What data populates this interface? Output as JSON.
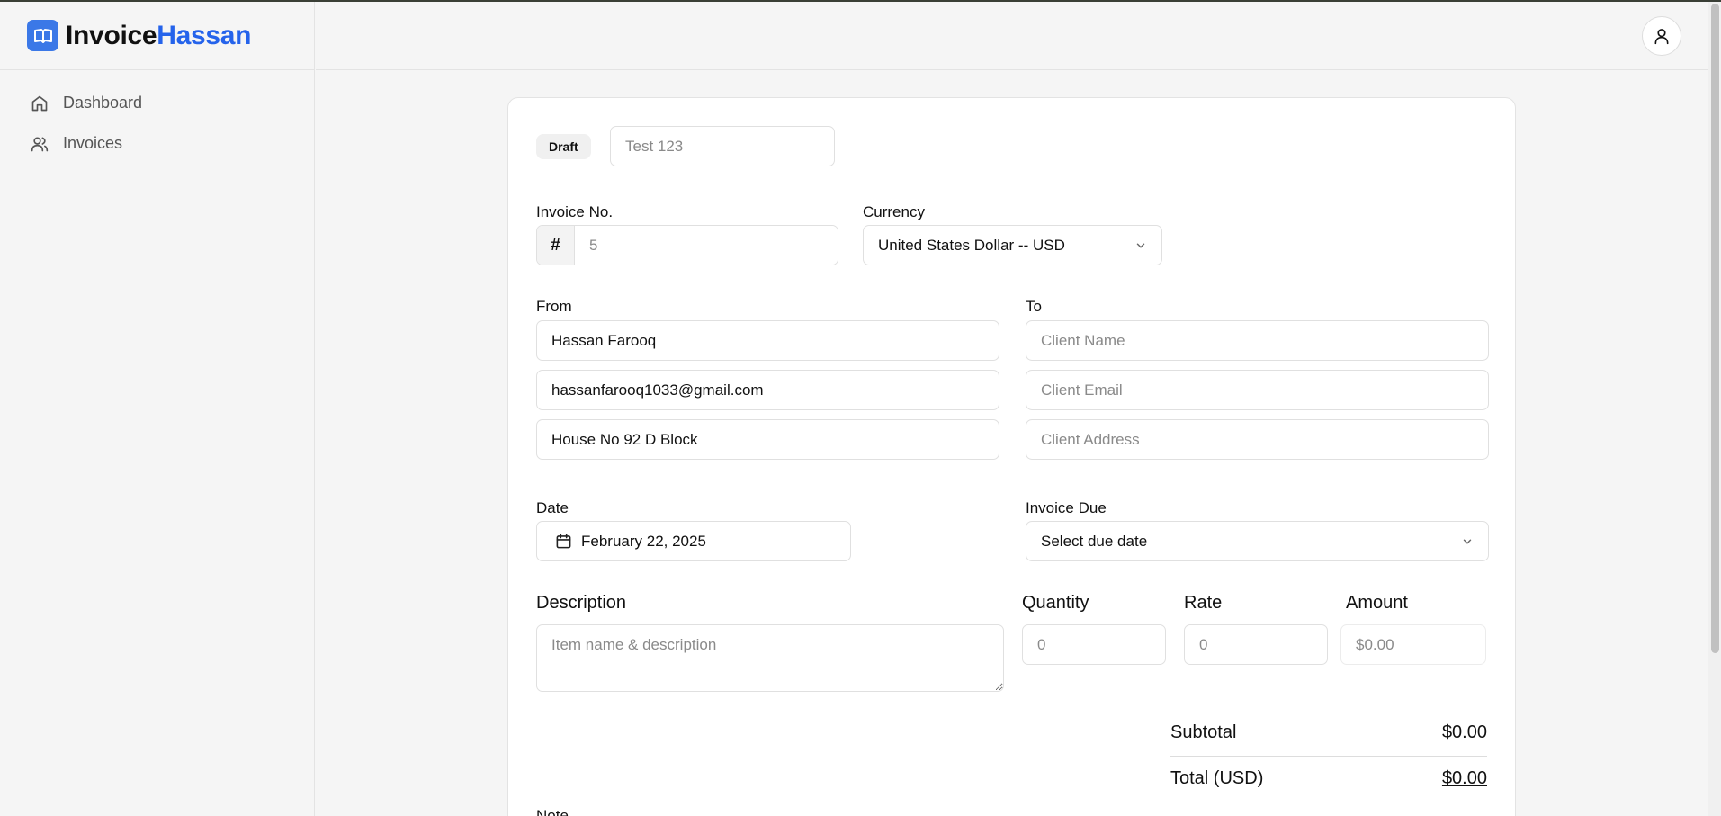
{
  "brand": {
    "name_part1": "Invoice",
    "name_part2": "Hassan",
    "accent": "#2563eb"
  },
  "sidebar": {
    "items": [
      {
        "label": "Dashboard",
        "icon": "home-icon"
      },
      {
        "label": "Invoices",
        "icon": "users-icon"
      }
    ]
  },
  "header": {
    "user_icon": "user-icon"
  },
  "invoice": {
    "status_badge": "Draft",
    "title_placeholder": "Test 123",
    "invoice_no_label": "Invoice No.",
    "invoice_no_prefix": "#",
    "invoice_no_placeholder": "5",
    "currency_label": "Currency",
    "currency_value": "United States Dollar -- USD",
    "from_label": "From",
    "from_name": "Hassan Farooq",
    "from_email": "hassanfarooq1033@gmail.com",
    "from_address": "House No 92 D Block",
    "to_label": "To",
    "to_name_placeholder": "Client Name",
    "to_email_placeholder": "Client Email",
    "to_address_placeholder": "Client Address",
    "date_label": "Date",
    "date_value": "February 22, 2025",
    "due_label": "Invoice Due",
    "due_value": "Select due date",
    "line_items": {
      "description_header": "Description",
      "quantity_header": "Quantity",
      "rate_header": "Rate",
      "amount_header": "Amount",
      "description_placeholder": "Item name & description",
      "quantity_placeholder": "0",
      "rate_placeholder": "0",
      "amount_value": "$0.00"
    },
    "subtotal_label": "Subtotal",
    "subtotal_value": "$0.00",
    "total_label": "Total (USD)",
    "total_value": "$0.00",
    "note_label": "Note"
  }
}
